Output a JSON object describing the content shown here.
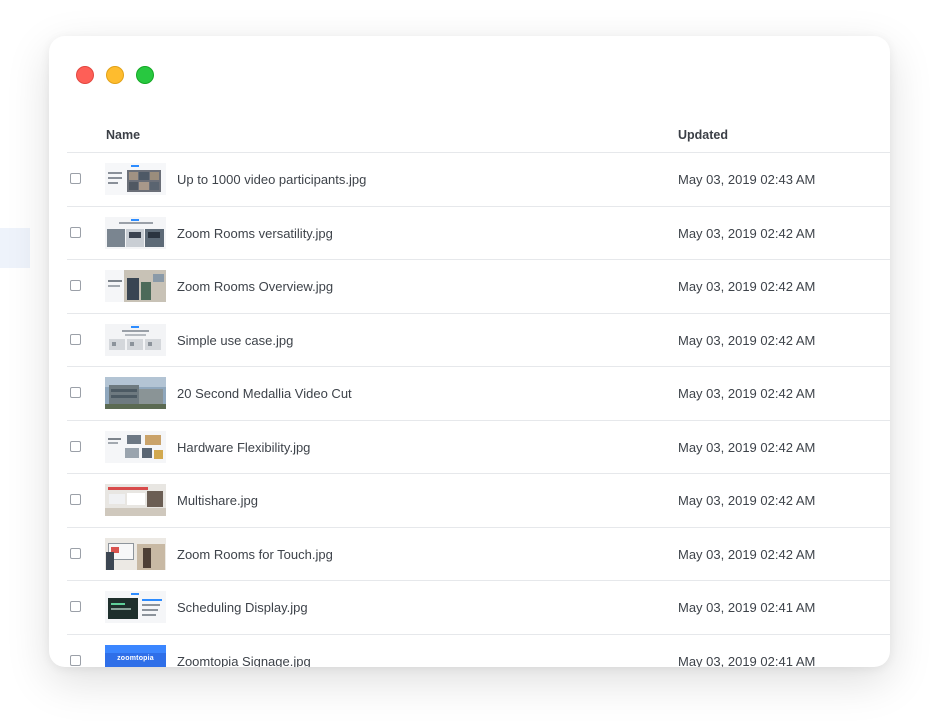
{
  "table": {
    "columns": {
      "name": "Name",
      "updated": "Updated"
    },
    "rows": [
      {
        "name": "Up to 1000 video participants.jpg",
        "updated": "May 03, 2019 02:43 AM",
        "thumb": "gallery-slide"
      },
      {
        "name": "Zoom Rooms versatility.jpg",
        "updated": "May 03, 2019 02:42 AM",
        "thumb": "rooms-slide"
      },
      {
        "name": "Zoom Rooms Overview.jpg",
        "updated": "May 03, 2019 02:42 AM",
        "thumb": "office-photo-slide"
      },
      {
        "name": "Simple use case.jpg",
        "updated": "May 03, 2019 02:42 AM",
        "thumb": "three-panel-slide"
      },
      {
        "name": "20 Second Medallia Video Cut",
        "updated": "May 03, 2019 02:42 AM",
        "thumb": "building-photo"
      },
      {
        "name": "Hardware Flexibility.jpg",
        "updated": "May 03, 2019 02:42 AM",
        "thumb": "hardware-slide"
      },
      {
        "name": "Multishare.jpg",
        "updated": "May 03, 2019 02:42 AM",
        "thumb": "multishare-slide"
      },
      {
        "name": "Zoom Rooms for Touch.jpg",
        "updated": "May 03, 2019 02:42 AM",
        "thumb": "touch-slide"
      },
      {
        "name": "Scheduling Display.jpg",
        "updated": "May 03, 2019 02:41 AM",
        "thumb": "scheduling-slide"
      },
      {
        "name": "Zoomtopia Signage.jpg",
        "updated": "May 03, 2019 02:41 AM",
        "thumb": "signage-slide",
        "thumb_text": "zoomtopia"
      }
    ]
  },
  "colors": {
    "close": "#fe5f57",
    "minimize": "#febc2e",
    "zoom": "#28c840",
    "zoom_blue": "#2d8cff",
    "row_divider": "#e6e8eb"
  }
}
